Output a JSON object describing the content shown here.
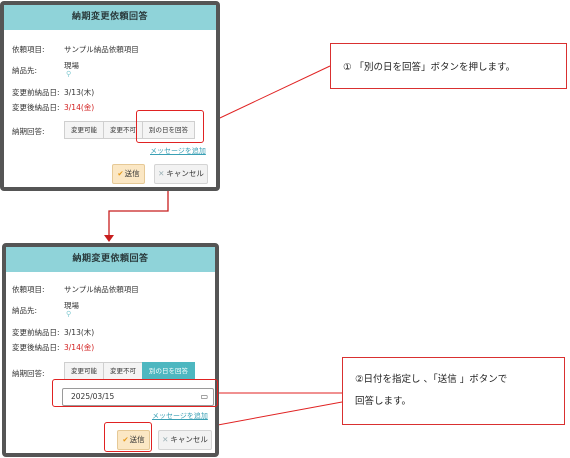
{
  "dialog": {
    "title": "納期変更依頼回答",
    "fields": {
      "request_item_label": "依頼項目:",
      "request_item_value": "サンプル納品依頼項目",
      "delivery_label": "納品先:",
      "delivery_value": "現場",
      "before_label": "変更前納品日:",
      "before_value": "3/13(木)",
      "after_label": "変更後納品日:",
      "after_value": "3/14(金)",
      "answer_label": "納期回答:"
    },
    "options": [
      "変更可能",
      "変更不可",
      "別の日を回答"
    ],
    "message_link": "メッセージを追加",
    "send_label": "送信",
    "cancel_label": "キャンセル"
  },
  "dialog2": {
    "date_value": "2025/03/15"
  },
  "callouts": {
    "step1": "① 「別の日を回答」ボタンを押します。",
    "step2_line1": "②日付を指定し 、「送信 」ボタンで",
    "step2_line2": "回答します。"
  },
  "colors": {
    "header": "#8fd3d9",
    "active_option": "#4db7c0",
    "highlight": "#e02222",
    "changed_date": "#d21f1f"
  }
}
